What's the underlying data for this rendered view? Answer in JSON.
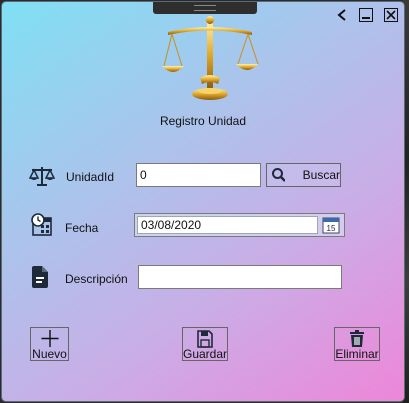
{
  "window": {
    "title": "Registro Unidad",
    "controls": {
      "back": "‹",
      "minimize": "minimize",
      "close": "close"
    }
  },
  "form": {
    "unidad_id": {
      "label": "UnidadId",
      "value": "0"
    },
    "buscar_label": "Buscar",
    "fecha": {
      "label": "Fecha",
      "value": "03/08/2020",
      "calendar_day": "15"
    },
    "descripcion": {
      "label": "Descripción",
      "value": ""
    }
  },
  "actions": {
    "nuevo_label": "Nuevo",
    "guardar_label": "Guardar",
    "eliminar_label": "Eliminar"
  },
  "colors": {
    "gradient_start": "#7fe0f4",
    "gradient_end": "#ee86d8",
    "icon_dark": "#1e2a3a"
  }
}
